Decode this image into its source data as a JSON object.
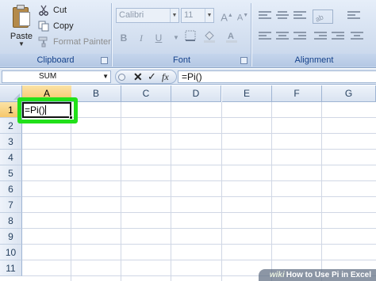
{
  "ribbon": {
    "clipboard": {
      "title": "Clipboard",
      "paste_label": "Paste",
      "cut_label": "Cut",
      "copy_label": "Copy",
      "format_painter_label": "Format Painter"
    },
    "font": {
      "title": "Font",
      "font_name": "Calibri",
      "font_size": "11",
      "bold": "B",
      "italic": "I",
      "underline": "U",
      "grow": "A",
      "shrink": "A"
    },
    "alignment": {
      "title": "Alignment"
    }
  },
  "formula_bar": {
    "name_box": "SUM",
    "cancel_symbol": "✕",
    "enter_symbol": "✓",
    "fx_label": "fx",
    "formula": "=Pi()"
  },
  "sheet": {
    "columns": [
      "A",
      "B",
      "C",
      "D",
      "E",
      "F",
      "G"
    ],
    "rows": [
      "1",
      "2",
      "3",
      "4",
      "5",
      "6",
      "7",
      "8",
      "9",
      "10",
      "11"
    ],
    "selected_column": "A",
    "selected_row": "1",
    "active_cell": {
      "ref": "A1",
      "value": "=Pi()"
    }
  },
  "watermark": {
    "brand": "wiki",
    "text": "How to Use Pi in Excel"
  },
  "colors": {
    "highlight": "#22e01a",
    "ribbon_bg": "#cfdcee",
    "header_selected": "#f6c76a"
  }
}
